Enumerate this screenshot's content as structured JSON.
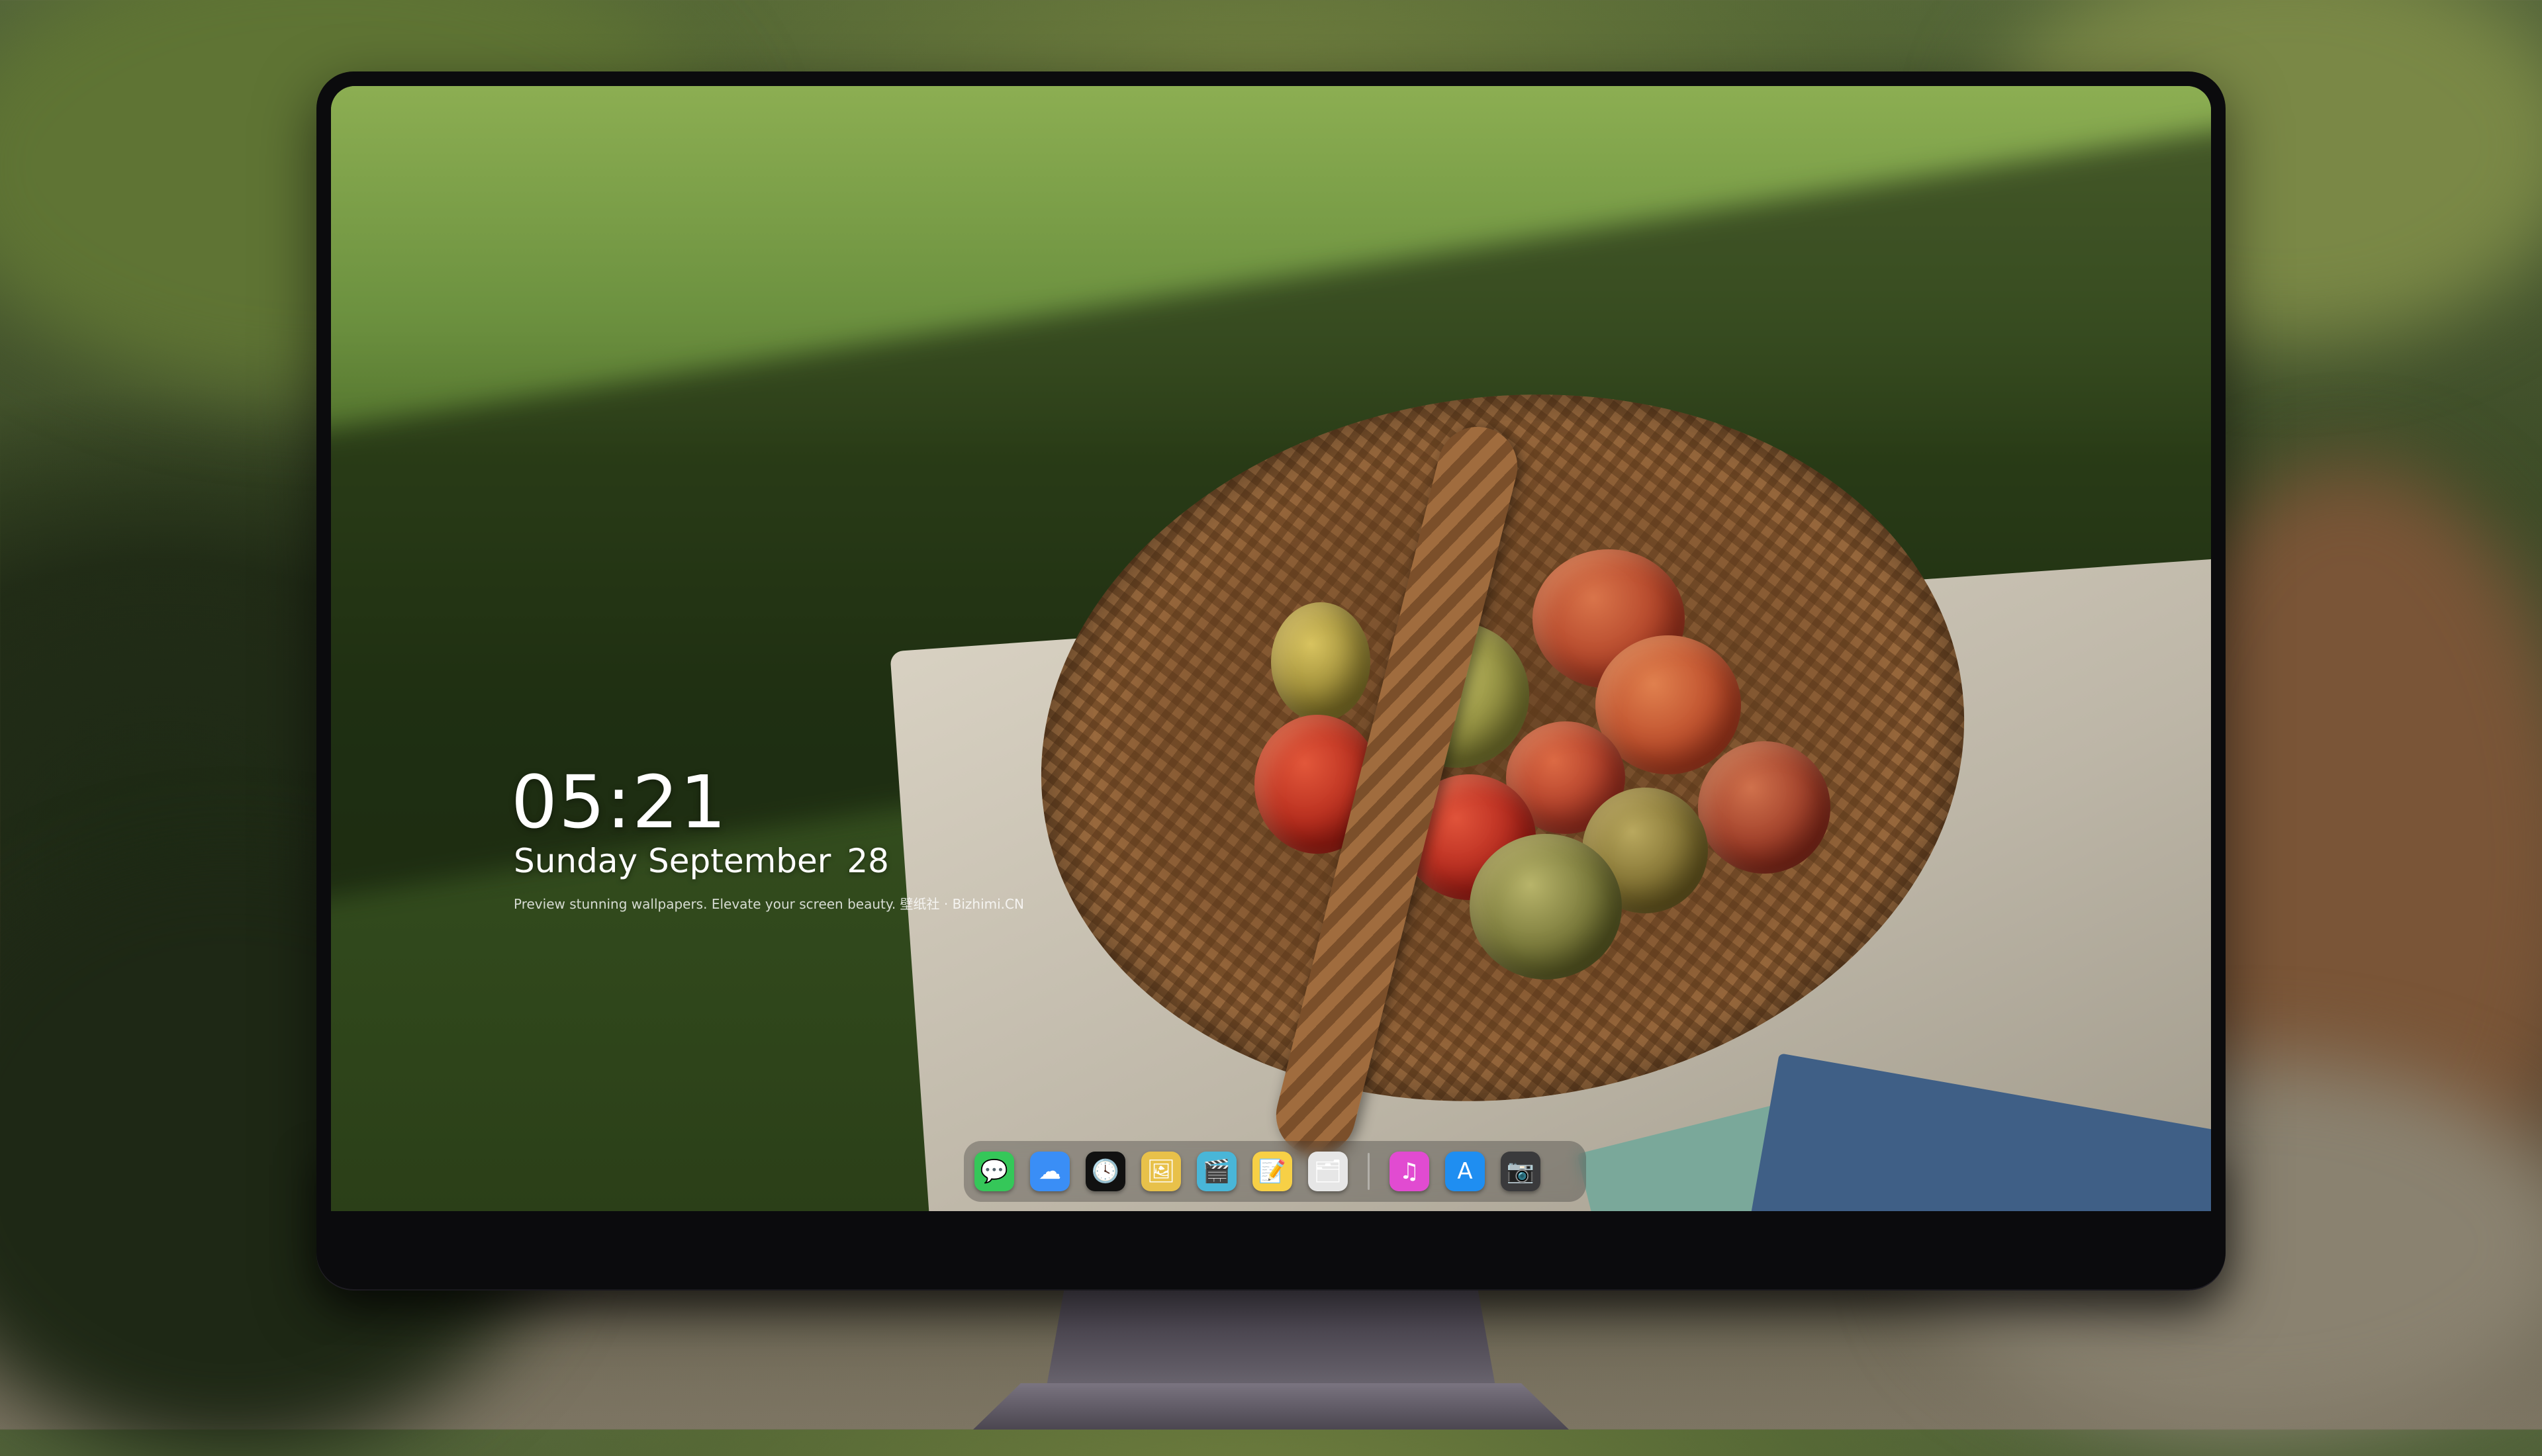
{
  "lockscreen": {
    "time": "05:21",
    "weekday_month": "Sunday September",
    "day": "28",
    "tagline": "Preview stunning wallpapers. Elevate your screen beauty. 壁纸社 · Bizhimi.CN"
  },
  "dock": {
    "apps": [
      {
        "name": "messages-icon",
        "glyph": "💬",
        "color": "#35c759"
      },
      {
        "name": "weather-icon",
        "glyph": "☁",
        "color": "#3a8ef6"
      },
      {
        "name": "clock-icon",
        "glyph": "🕓",
        "color": "#111111"
      },
      {
        "name": "preview-icon",
        "glyph": "🖼",
        "color": "#e8c14a"
      },
      {
        "name": "clapper-icon",
        "glyph": "🎬",
        "color": "#49b6d8"
      },
      {
        "name": "notes-icon",
        "glyph": "📝",
        "color": "#f7d046"
      },
      {
        "name": "photos-icon",
        "glyph": "🗂",
        "color": "#e6e6e6"
      }
    ],
    "apps_right": [
      {
        "name": "music-icon",
        "glyph": "♫",
        "color": "#e14bd1"
      },
      {
        "name": "app-store-icon",
        "glyph": "A",
        "color": "#1f8ef1"
      },
      {
        "name": "camera-icon",
        "glyph": "📷",
        "color": "#3a3a3c"
      }
    ]
  },
  "monitor": {
    "logo_name": "mascot-logo-icon"
  }
}
